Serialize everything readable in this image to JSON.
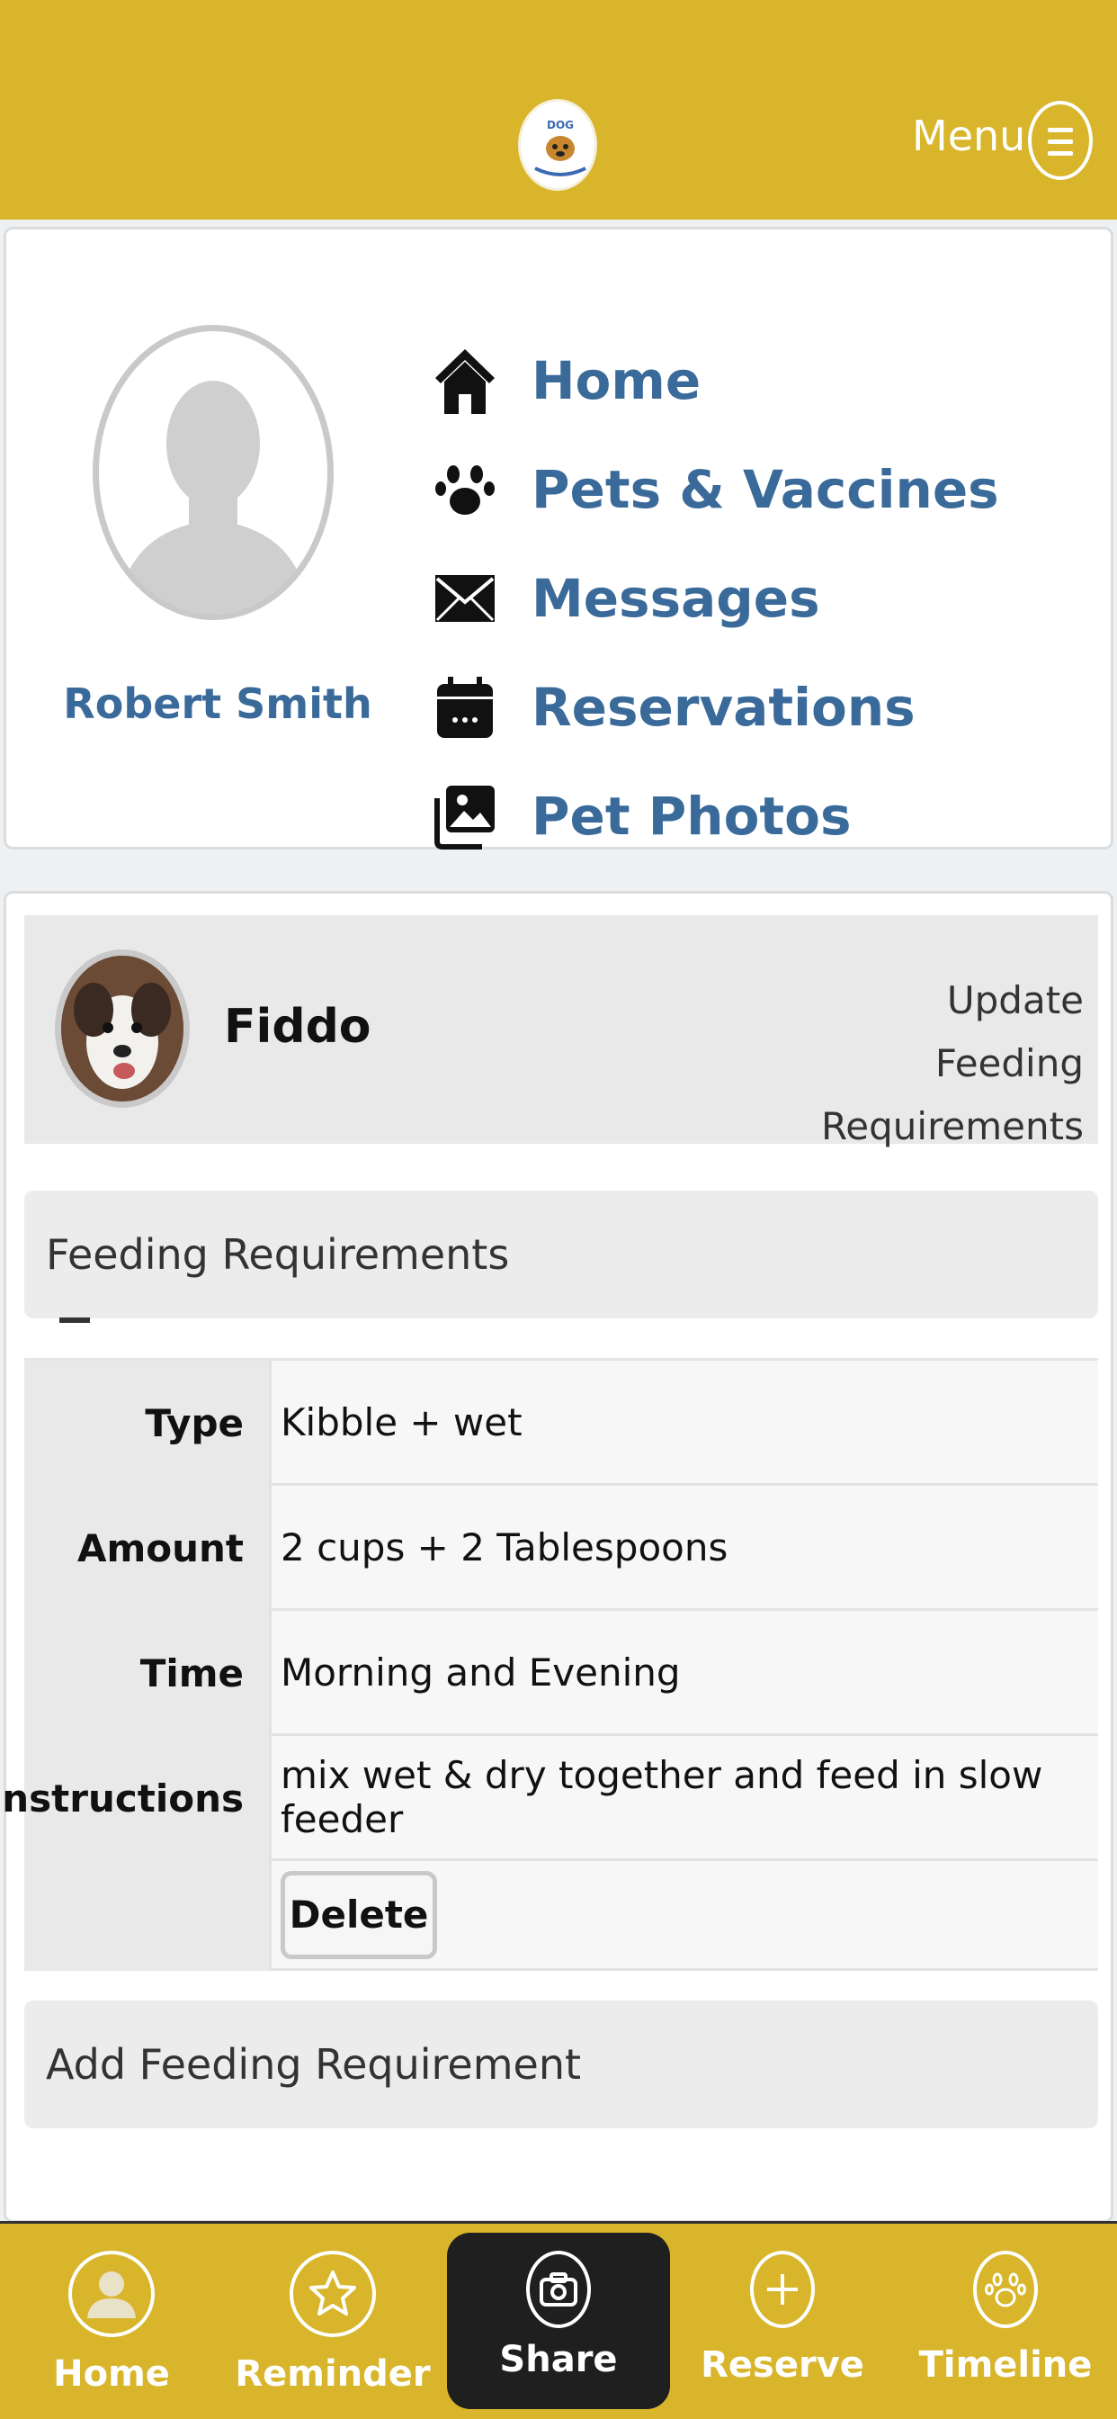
{
  "header": {
    "menu_label": "Menu",
    "logo_icon": "dog-logo-icon",
    "menu_icon": "hamburger-circle-icon",
    "background": "#d8b52a"
  },
  "profile": {
    "user_name": "Robert Smith",
    "avatar_icon": "user-silhouette-icon"
  },
  "nav": {
    "items": [
      {
        "label": "Home",
        "icon": "house-icon"
      },
      {
        "label": "Pets & Vaccines",
        "icon": "paw-icon"
      },
      {
        "label": "Messages",
        "icon": "envelope-icon"
      },
      {
        "label": "Reservations",
        "icon": "calendar-icon"
      },
      {
        "label": "Pet Photos",
        "icon": "photos-icon"
      }
    ],
    "link_color": "#3a6a9a"
  },
  "pet": {
    "name": "Fiddo",
    "update_link": "Update Feeding Requirements"
  },
  "feeding": {
    "section_title": "Feeding Requirements",
    "rows": [
      {
        "key": "Type",
        "value": "Kibble + wet"
      },
      {
        "key": "Amount",
        "value": "2 cups + 2 Tablespoons"
      },
      {
        "key": "Time",
        "value": "Morning and Evening"
      },
      {
        "key": "Instructions",
        "value": "mix wet & dry together and feed in slow feeder"
      }
    ],
    "delete_label": "Delete",
    "add_title": "Add Feeding Requirement"
  },
  "bottom_nav": {
    "tabs": [
      {
        "label": "Home",
        "icon": "person-circle-icon"
      },
      {
        "label": "Reminder",
        "icon": "star-icon"
      },
      {
        "label": "Share",
        "icon": "camera-icon",
        "active": true
      },
      {
        "label": "Reserve",
        "icon": "plus-icon"
      },
      {
        "label": "Timeline",
        "icon": "paw-icon"
      }
    ],
    "active_color": "#1f1f1f"
  }
}
